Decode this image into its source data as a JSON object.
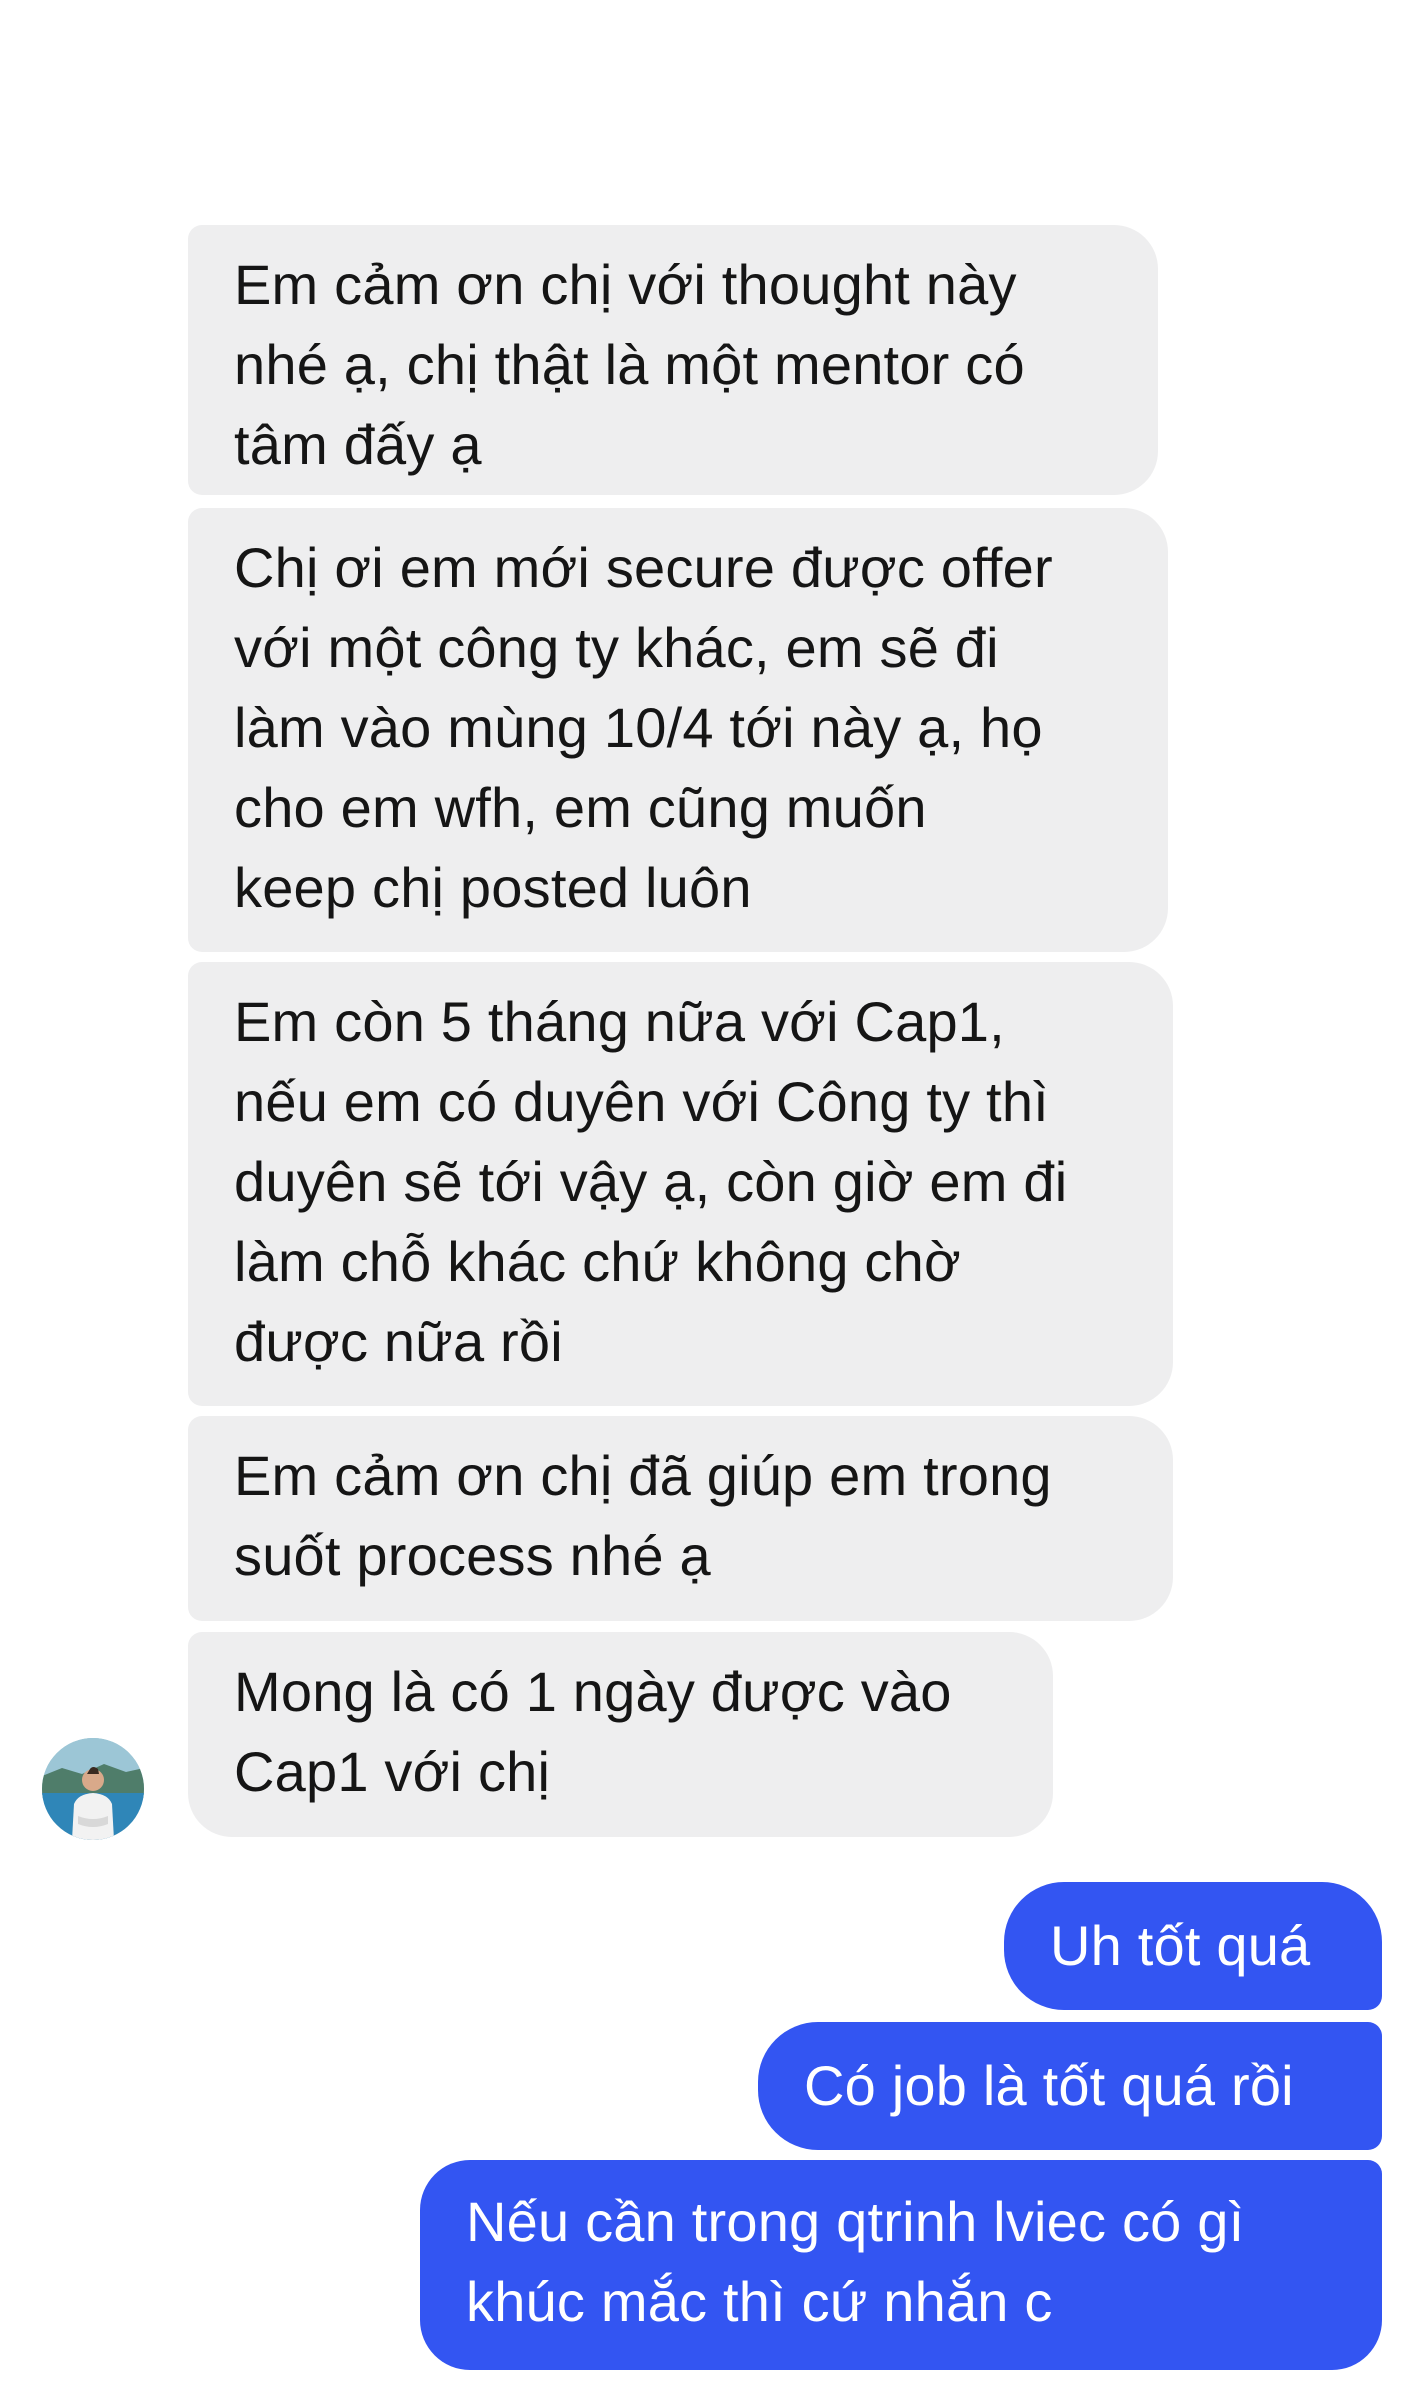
{
  "conversation": {
    "incoming": [
      {
        "text": "Em cảm ơn chị với thought này\nnhé ạ, chị thật là một mentor có\ntâm đấy ạ"
      },
      {
        "text": "Chị ơi em mới secure được offer\nvới một công ty khác, em sẽ đi\nlàm vào mùng 10/4 tới này ạ, họ\ncho em wfh, em cũng muốn\nkeep chị posted luôn"
      },
      {
        "text": "Em còn 5 tháng nữa với Cap1,\nnếu em có duyên với Công ty thì\nduyên sẽ tới vậy ạ, còn giờ em đi\nlàm chỗ khác chứ không chờ\nđược nữa rồi"
      },
      {
        "text": "Em cảm ơn chị đã giúp em trong\nsuốt process nhé ạ"
      },
      {
        "text": "Mong là có 1 ngày được vào\nCap1 với chị"
      }
    ],
    "outgoing": [
      {
        "text": "Uh tốt quá"
      },
      {
        "text": "Có job là tốt quá rồi"
      },
      {
        "text": "Nếu cần trong qtrinh lviec có gì\nkhúc mắc thì cứ nhắn c"
      }
    ],
    "avatar_icon": "sender-avatar-photo"
  },
  "colors": {
    "incoming_bubble": "#eeeeef",
    "outgoing_bubble": "#3355f2",
    "incoming_text": "#151515",
    "outgoing_text": "#ffffff"
  }
}
